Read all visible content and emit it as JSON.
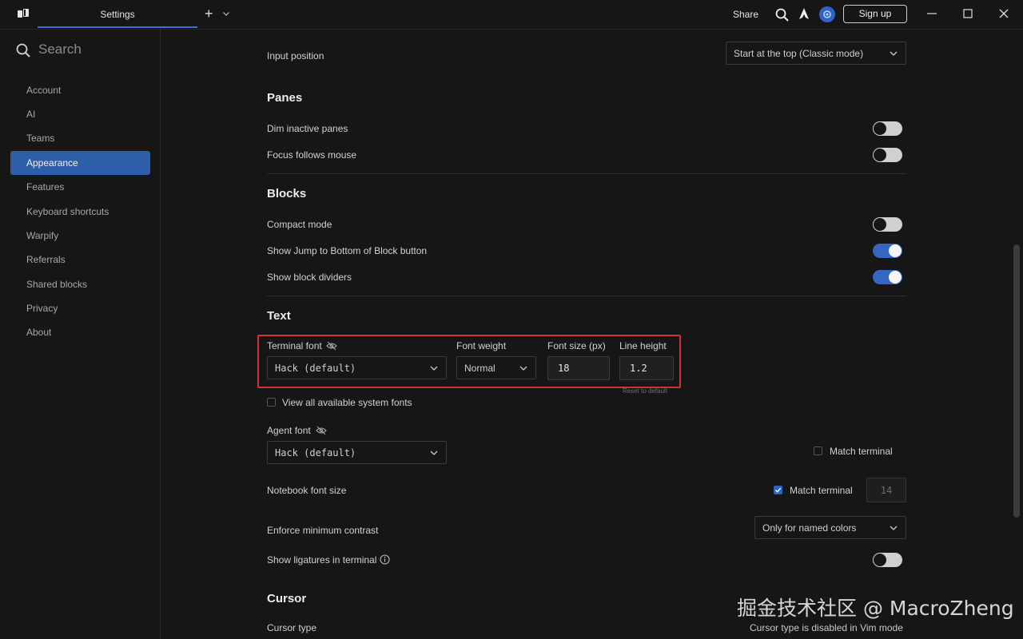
{
  "titlebar": {
    "tab_title": "Settings",
    "new_tab_symbol": "+",
    "share_label": "Share",
    "signup_label": "Sign up"
  },
  "sidebar": {
    "search_placeholder": "Search",
    "items": [
      {
        "label": "Account"
      },
      {
        "label": "AI"
      },
      {
        "label": "Teams"
      },
      {
        "label": "Appearance",
        "active": true
      },
      {
        "label": "Features"
      },
      {
        "label": "Keyboard shortcuts"
      },
      {
        "label": "Warpify"
      },
      {
        "label": "Referrals"
      },
      {
        "label": "Shared blocks"
      },
      {
        "label": "Privacy"
      },
      {
        "label": "About"
      }
    ]
  },
  "main": {
    "input_position": {
      "label": "Input position",
      "value": "Start at the top (Classic mode)"
    },
    "panes": {
      "title": "Panes",
      "dim_inactive": {
        "label": "Dim inactive panes",
        "on": false
      },
      "focus_follows": {
        "label": "Focus follows mouse",
        "on": false
      }
    },
    "blocks": {
      "title": "Blocks",
      "compact": {
        "label": "Compact mode",
        "on": false
      },
      "jump_bottom": {
        "label": "Show Jump to Bottom of Block button",
        "on": true
      },
      "dividers": {
        "label": "Show block dividers",
        "on": true
      }
    },
    "text": {
      "title": "Text",
      "terminal_font": {
        "label": "Terminal font",
        "value": "Hack (default)"
      },
      "font_weight": {
        "label": "Font weight",
        "value": "Normal"
      },
      "font_size": {
        "label": "Font size (px)",
        "value": "18"
      },
      "line_height": {
        "label": "Line height",
        "value": "1.2"
      },
      "reset_label": "Reset to default",
      "view_all_fonts": {
        "label": "View all available system fonts",
        "checked": false
      },
      "agent_font": {
        "label": "Agent font",
        "value": "Hack (default)"
      },
      "agent_match": {
        "label": "Match terminal",
        "checked": false
      },
      "notebook": {
        "label": "Notebook font size",
        "match_label": "Match terminal",
        "checked": true,
        "value": "14"
      },
      "contrast": {
        "label": "Enforce minimum contrast",
        "value": "Only for named colors"
      },
      "ligatures": {
        "label": "Show ligatures in terminal",
        "on": false
      }
    },
    "cursor": {
      "title": "Cursor",
      "type_label": "Cursor type",
      "note": "Cursor type is disabled in Vim mode"
    }
  },
  "watermark": "掘金技术社区 @ MacroZheng",
  "colors": {
    "accent": "#2f63c7",
    "highlight": "#d3303a",
    "background": "#161616"
  }
}
